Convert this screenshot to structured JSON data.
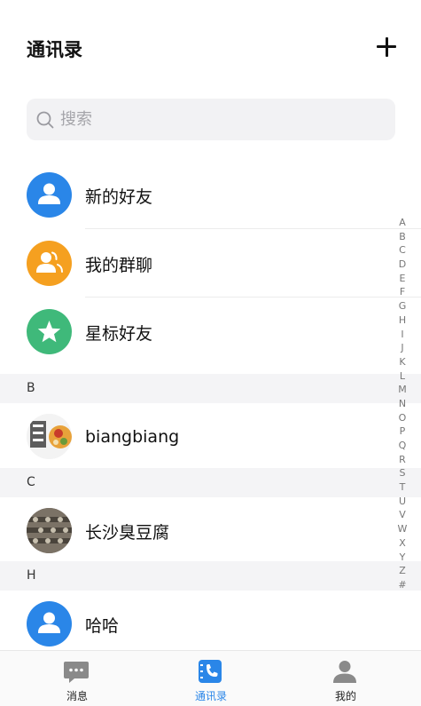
{
  "header": {
    "title": "通讯录"
  },
  "search": {
    "placeholder": "搜索"
  },
  "quick_items": [
    {
      "label": "新的好友",
      "icon": "person-icon",
      "color": "#2a86e8"
    },
    {
      "label": "我的群聊",
      "icon": "group-icon",
      "color": "#f5a020"
    },
    {
      "label": "星标好友",
      "icon": "star-icon",
      "color": "#3fb97a"
    }
  ],
  "sections": [
    {
      "letter": "B",
      "contacts": [
        {
          "name": "biangbiang"
        }
      ]
    },
    {
      "letter": "C",
      "contacts": [
        {
          "name": "长沙臭豆腐"
        }
      ]
    },
    {
      "letter": "H",
      "contacts": [
        {
          "name": "哈哈"
        }
      ]
    }
  ],
  "index": [
    "A",
    "B",
    "C",
    "D",
    "E",
    "F",
    "G",
    "H",
    "I",
    "J",
    "K",
    "L",
    "M",
    "N",
    "O",
    "P",
    "Q",
    "R",
    "S",
    "T",
    "U",
    "V",
    "W",
    "X",
    "Y",
    "Z",
    "#"
  ],
  "tabs": [
    {
      "label": "消息",
      "icon": "chat-bubble-icon"
    },
    {
      "label": "通讯录",
      "icon": "contacts-icon",
      "active": true
    },
    {
      "label": "我的",
      "icon": "profile-icon"
    }
  ],
  "colors": {
    "accent": "#2a86e8",
    "inactive_icon": "#8a8a8a"
  }
}
